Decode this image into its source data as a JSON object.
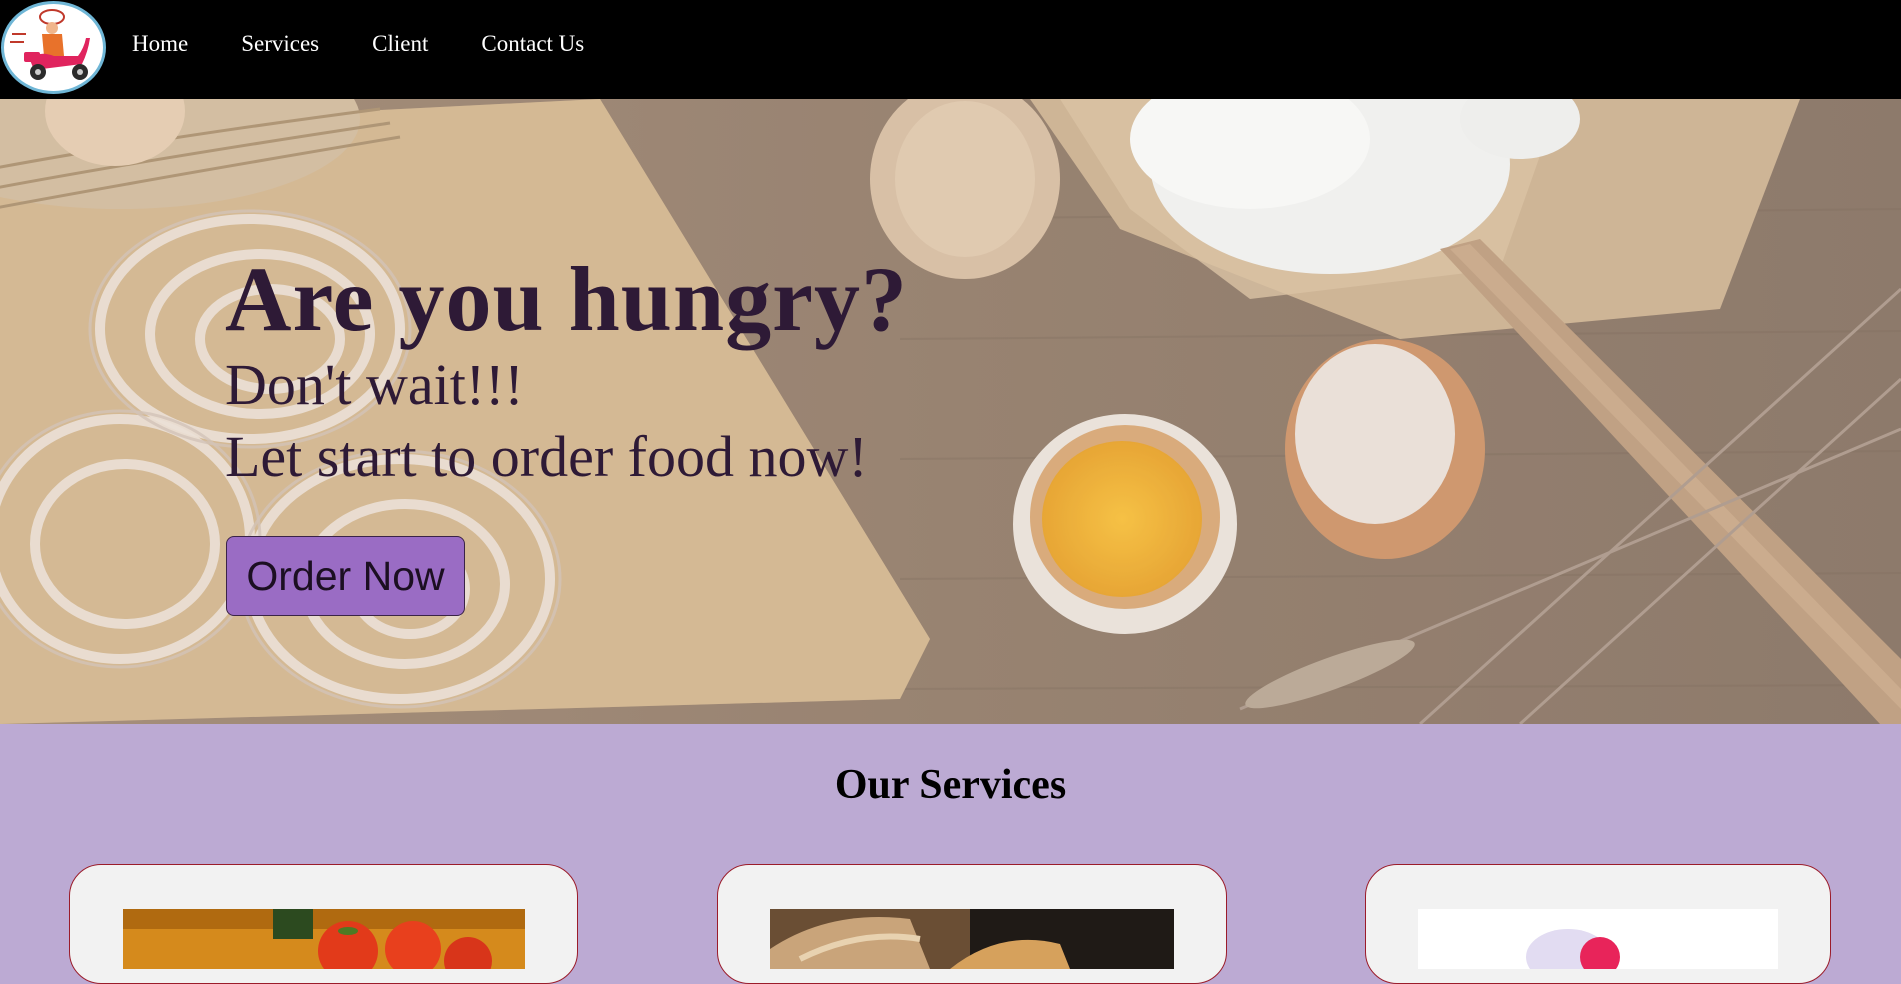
{
  "nav": {
    "logo_alt": "food delivery scooter logo",
    "links": [
      "Home",
      "Services",
      "Client",
      "Contact Us"
    ]
  },
  "hero": {
    "title": "Are you hungry?",
    "line1": "Don't wait!!!",
    "line2": "Let start to order food now!",
    "cta": "Order Now"
  },
  "services": {
    "title": "Our Services",
    "cards": [
      {
        "image": "tomatoes-image"
      },
      {
        "image": "bread-image"
      },
      {
        "image": "delivery-illustration-image"
      }
    ]
  },
  "colors": {
    "nav_bg": "#000000",
    "accent_purple": "#9a6cc4",
    "section_bg": "#bcaad3",
    "card_border": "#9b1c2a",
    "hero_text": "#2e1a36"
  }
}
